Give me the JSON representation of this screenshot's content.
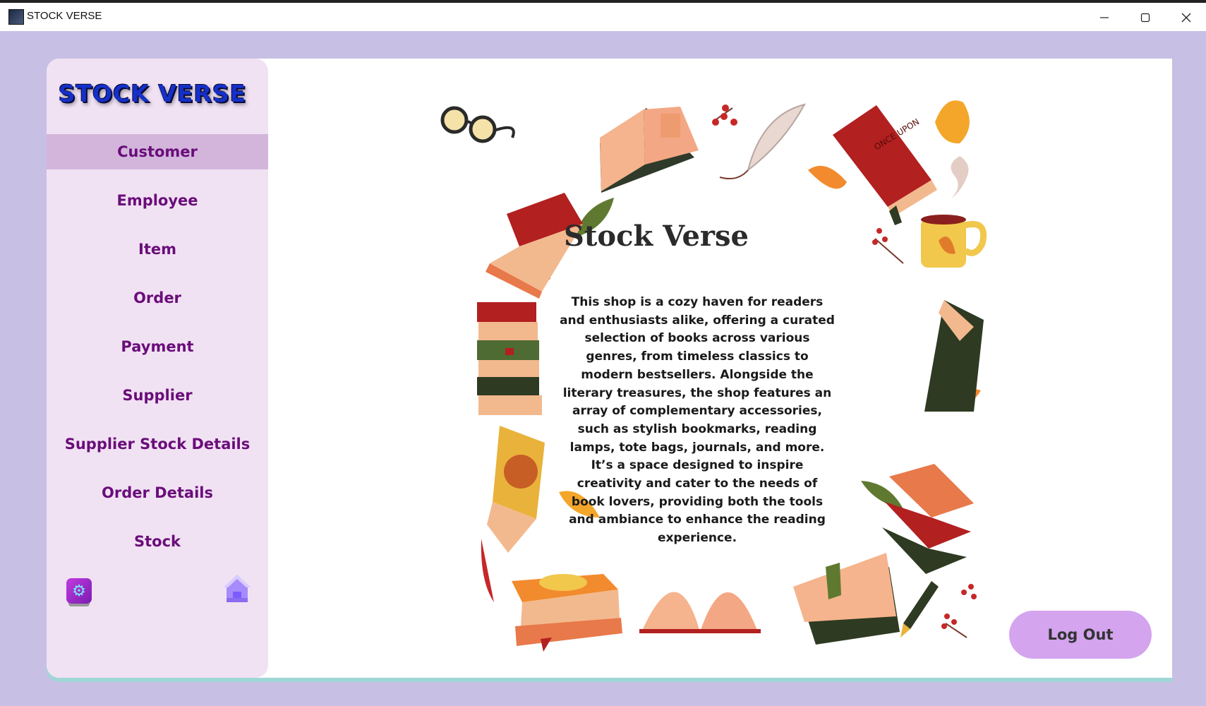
{
  "window": {
    "title": "STOCK VERSE",
    "minimize_icon": "minimize-icon",
    "maximize_icon": "maximize-icon",
    "close_icon": "close-icon"
  },
  "sidebar": {
    "brand": "STOCK VERSE",
    "active_item": "Customer",
    "items": [
      {
        "label": "Customer"
      },
      {
        "label": "Employee"
      },
      {
        "label": "Item"
      },
      {
        "label": "Order"
      },
      {
        "label": "Payment"
      },
      {
        "label": "Supplier"
      },
      {
        "label": "Supplier Stock Details"
      },
      {
        "label": "Order Details"
      },
      {
        "label": "Stock"
      }
    ],
    "settings_icon": "gear-icon",
    "home_icon": "home-icon"
  },
  "main": {
    "title": "Stock Verse",
    "description": "This shop is a cozy haven for readers and enthusiasts alike, offering a curated selection of books across various genres, from timeless classics to modern bestsellers. Alongside the literary treasures, the shop features an array of complementary accessories, such as stylish bookmarks, reading lamps, tote bags, journals, and more. It’s a space designed to inspire creativity and cater to the needs of book lovers, providing both the tools and ambiance to enhance the reading experience.",
    "decorations": [
      "glasses",
      "open-book",
      "berries",
      "feather",
      "red-book",
      "autumn-leaf",
      "tea-cup",
      "book-stack",
      "green-book",
      "yellow-book",
      "pen"
    ],
    "logout_label": "Log Out"
  },
  "colors": {
    "window_bg": "#c8bfe5",
    "sidebar_bg": "#f1e2f3",
    "active_item_bg": "#d3b5dc",
    "nav_text": "#6a0d7a",
    "brand": "#1530c8",
    "logout_bg": "#d4a4ef"
  }
}
